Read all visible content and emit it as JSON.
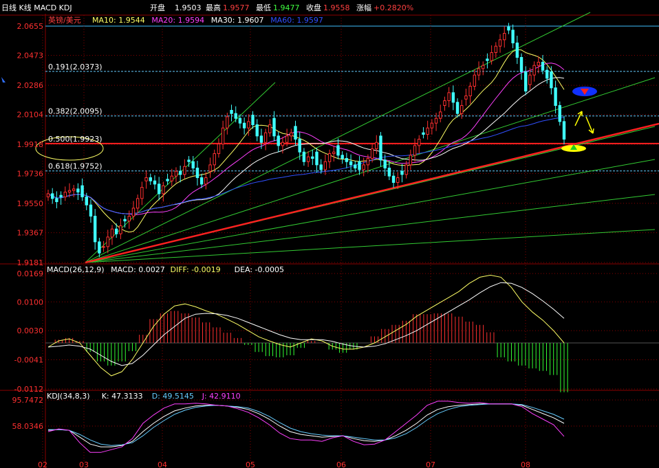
{
  "header": {
    "title": "日线 K线 MACD KDJ",
    "stats": [
      {
        "label": "开盘",
        "value": "1.9503",
        "label_color": "#ffffff",
        "value_color": "#ffffff"
      },
      {
        "label": "最高",
        "value": "1.9577",
        "label_color": "#ffffff",
        "value_color": "#ff4040"
      },
      {
        "label": "最低",
        "value": "1.9477",
        "label_color": "#ffffff",
        "value_color": "#40ff40"
      },
      {
        "label": "收盘",
        "value": "1.9558",
        "label_color": "#ffffff",
        "value_color": "#ff4040"
      },
      {
        "label": "涨幅",
        "value": "+0.2820%",
        "label_color": "#ffffff",
        "value_color": "#ff4040"
      }
    ]
  },
  "price_panel": {
    "symbol": "英镑/美元",
    "ma_legend": [
      {
        "label": "MA10: 1.9544",
        "color": "#ffff66"
      },
      {
        "label": "MA20: 1.9594",
        "color": "#ff40ff"
      },
      {
        "label": "MA30: 1.9607",
        "color": "#ffffff"
      },
      {
        "label": "MA60: 1.9597",
        "color": "#3050ff"
      }
    ],
    "fib_labels": [
      "0.191(2.0373)",
      "0.382(2.0095)",
      "0.500(1.9923)",
      "0.618(1.9752)"
    ]
  },
  "macd_panel": {
    "legend": [
      {
        "label": "MACD(26,12,9)",
        "color": "#ffffff"
      },
      {
        "label": "MACD: 0.0027",
        "color": "#ffffff"
      },
      {
        "label": "DIFF: -0.0019",
        "color": "#ffff66"
      },
      {
        "label": "DEA: -0.0005",
        "color": "#ffffff"
      }
    ]
  },
  "kdj_panel": {
    "legend": [
      {
        "label": "KDJ(34,8,3)",
        "color": "#ffffff"
      },
      {
        "label": "K: 47.3133",
        "color": "#ffffff"
      },
      {
        "label": "D: 49.5145",
        "color": "#66ccff"
      },
      {
        "label": "J: 42.9110",
        "color": "#ff40ff"
      }
    ]
  },
  "colors": {
    "up": "#ff3030",
    "down": "#40ffff",
    "grid": "#8b0000",
    "axis_text": "#ff3030",
    "fan": "#33cc33",
    "support": "#ff2020"
  },
  "chart_data": [
    {
      "type": "candlestick",
      "title": "英镑/美元",
      "ylim": [
        1.9181,
        2.0655
      ],
      "y_ticks": [
        2.0655,
        2.0473,
        2.0286,
        2.0104,
        1.9918,
        1.9736,
        1.955,
        1.9367,
        1.9181
      ],
      "x_ticks": [
        "02",
        "03",
        "04",
        "05",
        "06",
        "07",
        "08"
      ],
      "closes": [
        1.961,
        1.958,
        1.956,
        1.959,
        1.962,
        1.963,
        1.964,
        1.962,
        1.959,
        1.954,
        1.947,
        1.931,
        1.924,
        1.928,
        1.934,
        1.939,
        1.936,
        1.941,
        1.944,
        1.947,
        1.952,
        1.958,
        1.965,
        1.971,
        1.969,
        1.967,
        1.961,
        1.966,
        1.969,
        1.972,
        1.975,
        1.973,
        1.978,
        1.981,
        1.977,
        1.971,
        1.967,
        1.971,
        1.979,
        1.986,
        1.992,
        2.002,
        2.009,
        2.011,
        2.008,
        2.005,
        2.002,
        2.006,
        2.004,
        1.997,
        1.993,
        1.999,
        2.004,
        1.997,
        1.991,
        1.993,
        1.997,
        1.999,
        1.995,
        1.987,
        1.981,
        1.984,
        1.983,
        1.979,
        1.976,
        1.981,
        1.986,
        1.987,
        1.985,
        1.983,
        1.981,
        1.979,
        1.977,
        1.976,
        1.979,
        1.983,
        1.989,
        1.993,
        1.982,
        1.977,
        1.972,
        1.968,
        1.971,
        1.973,
        1.979,
        1.985,
        1.991,
        1.995,
        1.998,
        2.002,
        2.005,
        2.008,
        2.012,
        2.019,
        2.024,
        2.018,
        2.011,
        2.016,
        2.022,
        2.028,
        2.035,
        2.039,
        2.041,
        2.044,
        2.049,
        2.053,
        2.057,
        2.061,
        2.063,
        2.055,
        2.046,
        2.037,
        2.025,
        2.035,
        2.041,
        2.043,
        2.038,
        2.033,
        2.027,
        2.016,
        2.006,
        1.995
      ]
    },
    {
      "type": "bar",
      "title": "MACD(26,12,9)",
      "ylim": [
        -0.0112,
        0.0169
      ],
      "y_ticks": [
        0.0169,
        0.01,
        0.003,
        -0.0041,
        -0.0112
      ],
      "series": [
        {
          "name": "DIFF",
          "values": [
            -0.001,
            0.0005,
            0.001,
            0.0,
            -0.003,
            -0.006,
            -0.008,
            -0.007,
            -0.004,
            0.0,
            0.004,
            0.007,
            0.009,
            0.0095,
            0.0088,
            0.0078,
            0.007,
            0.0058,
            0.0045,
            0.003,
            0.0015,
            0.0005,
            -0.0004,
            -0.001,
            0.0,
            0.001,
            0.0005,
            -0.0008,
            -0.0015,
            -0.0015,
            -0.001,
            0.0,
            0.0015,
            0.003,
            0.0045,
            0.0065,
            0.008,
            0.0095,
            0.011,
            0.0125,
            0.0145,
            0.016,
            0.0165,
            0.016,
            0.0135,
            0.01,
            0.0075,
            0.0055,
            0.003,
            0.0
          ]
        },
        {
          "name": "DEA",
          "values": [
            -0.001,
            -0.0008,
            -0.0005,
            -0.0008,
            -0.0015,
            -0.003,
            -0.0045,
            -0.0055,
            -0.005,
            -0.003,
            -0.0005,
            0.002,
            0.004,
            0.006,
            0.007,
            0.0072,
            0.0071,
            0.0067,
            0.006,
            0.005,
            0.004,
            0.003,
            0.002,
            0.0012,
            0.0008,
            0.0008,
            0.0008,
            0.0004,
            -0.0003,
            -0.0008,
            -0.001,
            -0.0008,
            -0.0002,
            0.0008,
            0.0018,
            0.003,
            0.0045,
            0.006,
            0.0075,
            0.009,
            0.0105,
            0.0122,
            0.0137,
            0.0147,
            0.0145,
            0.0135,
            0.012,
            0.0102,
            0.0082,
            0.006
          ]
        },
        {
          "name": "MACD",
          "values": [
            0.0,
            0.0008,
            0.0012,
            0.0005,
            -0.0022,
            -0.0045,
            -0.0055,
            -0.0045,
            -0.002,
            0.002,
            0.0058,
            0.0072,
            0.0078,
            0.0072,
            0.0062,
            0.005,
            0.0038,
            0.0025,
            0.0012,
            -0.0005,
            -0.0022,
            -0.0032,
            -0.0035,
            -0.003,
            -0.0012,
            0.0005,
            0.0001,
            -0.0016,
            -0.0024,
            -0.0016,
            0.0,
            0.0016,
            0.0034,
            0.0044,
            0.0054,
            0.007,
            0.007,
            0.0072,
            0.0072,
            0.0064,
            0.0052,
            0.0044,
            0.0026,
            -0.0035,
            -0.0045,
            -0.0055,
            -0.0062,
            -0.0068,
            -0.0078,
            -0.012
          ]
        }
      ]
    },
    {
      "type": "line",
      "title": "KDJ(34,8,3)",
      "ylim": [
        20.3,
        95.7472
      ],
      "y_ticks": [
        95.7472,
        58.0346
      ],
      "series": [
        {
          "name": "K",
          "values": [
            52,
            53,
            52,
            42,
            32,
            28,
            28,
            30,
            36,
            50,
            62,
            72,
            80,
            84,
            87,
            88,
            88,
            87,
            85,
            82,
            76,
            68,
            58,
            50,
            46,
            44,
            42,
            43,
            44,
            40,
            37,
            36,
            38,
            44,
            52,
            62,
            74,
            82,
            86,
            88,
            89,
            90,
            90,
            90,
            90,
            88,
            82,
            76,
            70,
            62
          ]
        },
        {
          "name": "D",
          "values": [
            53,
            53,
            52,
            46,
            38,
            32,
            30,
            31,
            34,
            44,
            56,
            66,
            75,
            81,
            85,
            87,
            88,
            87,
            86,
            84,
            79,
            72,
            63,
            55,
            50,
            47,
            45,
            44,
            44,
            42,
            40,
            38,
            38,
            41,
            47,
            56,
            67,
            76,
            82,
            86,
            88,
            89,
            90,
            90,
            90,
            89,
            85,
            80,
            75,
            68
          ]
        },
        {
          "name": "J",
          "values": [
            50,
            54,
            52,
            34,
            20,
            20,
            24,
            28,
            40,
            62,
            74,
            84,
            90,
            90,
            91,
            90,
            88,
            87,
            83,
            78,
            70,
            60,
            48,
            40,
            38,
            38,
            36,
            41,
            44,
            36,
            31,
            32,
            38,
            50,
            62,
            74,
            88,
            94,
            94,
            92,
            91,
            92,
            90,
            90,
            90,
            86,
            76,
            68,
            60,
            43
          ]
        }
      ]
    }
  ]
}
